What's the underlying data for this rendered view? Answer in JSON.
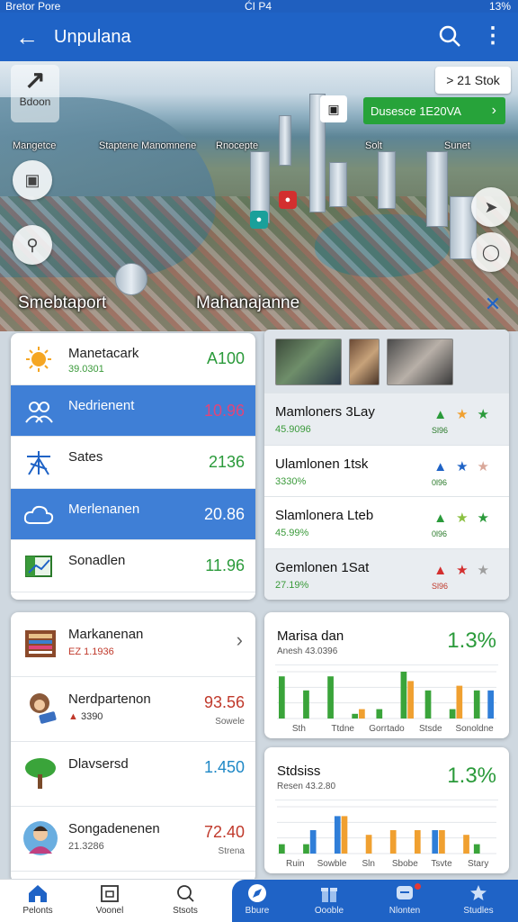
{
  "status_bar": {
    "left": "Bretor Pore",
    "center": "ĆI P4",
    "right": "13%"
  },
  "app_bar": {
    "title": "Unpulana"
  },
  "map": {
    "square_btn_label": "Bdoon",
    "square_label": "Mangetce",
    "time_chip": "> 21 Stok",
    "status_chip": "Dusesce 1E20VA",
    "labels": [
      "Staptene Manomnene",
      "Rnocepte",
      "Solt",
      "Sunet"
    ]
  },
  "sections": {
    "left_title": "Smebtaport",
    "right_title": "Mahanajanne"
  },
  "list": [
    {
      "name": "Manetacark",
      "sub": "39.0301",
      "value": "A100",
      "value_color": "#2a9a3a",
      "active": false,
      "icon": "sun-icon"
    },
    {
      "name": "Nedrienent",
      "sub": "",
      "value": "10.96",
      "value_color": "#e0457a",
      "active": true,
      "icon": "group-icon"
    },
    {
      "name": "Sates",
      "sub": "",
      "value": "2136",
      "value_color": "#2a9a3a",
      "active": false,
      "icon": "antenna-icon"
    },
    {
      "name": "Merlenanen",
      "sub": "",
      "value": "20.86",
      "value_color": "#ffffff",
      "active": true,
      "icon": "cloud-icon"
    },
    {
      "name": "Sonadlen",
      "sub": "",
      "value": "11.96",
      "value_color": "#2a9a3a",
      "active": false,
      "icon": "chart-icon"
    }
  ],
  "media": [
    {
      "name": "Mamloners 3Lay",
      "sub": "45.9096",
      "tiny": "Sl96",
      "stars": [
        "#2a9a3a",
        "#f0a030",
        "#2a9a3a"
      ]
    },
    {
      "name": "Ulamlonen 1tsk",
      "sub": "3330%",
      "tiny": "0l96",
      "stars": [
        "#1f63c6",
        "#1f63c6",
        "#d9a89a"
      ]
    },
    {
      "name": "Slamlonera Lteb",
      "sub": "45.99%",
      "tiny": "0l96",
      "stars": [
        "#2a9a3a",
        "#8ac040",
        "#2a9a3a"
      ]
    },
    {
      "name": "Gemlonen 1Sat",
      "sub": "27.19%",
      "tiny": "Sl96",
      "stars": [
        "#d32f2f",
        "#d32f2f",
        "#9e9e9e"
      ]
    }
  ],
  "users": [
    {
      "name": "Markanenan",
      "sub": "EZ 1.1936",
      "value": "",
      "vsub": "",
      "value_color": "#333",
      "chevron": true,
      "icon": "book-icon"
    },
    {
      "name": "Nerdpartenon",
      "sub": "3390",
      "value": "93.56",
      "vsub": "Sowele",
      "value_color": "#c0392b",
      "chevron": false,
      "icon": "person-icon"
    },
    {
      "name": "Dlavsersd",
      "sub": "",
      "value": "1.450",
      "vsub": "",
      "value_color": "#1f88c6",
      "chevron": false,
      "icon": "tree-icon"
    },
    {
      "name": "Songadenenen",
      "sub": "21.3286",
      "value": "72.40",
      "vsub": "Strena",
      "value_color": "#c0392b",
      "chevron": false,
      "icon": "avatar-icon"
    }
  ],
  "stats": [
    {
      "title": "Marisa dan",
      "sub": "Anesh 43.0396",
      "pct": "1.3%",
      "chart_data": {
        "type": "bar",
        "categories": [
          "Sth",
          "Ttdne",
          "Gorrtado",
          "Stsde",
          "Sonoldne"
        ],
        "series": [
          {
            "color": "#3aa43a",
            "values": [
              9,
              6,
              9,
              1,
              2,
              10,
              6,
              2,
              6
            ]
          },
          {
            "color": "#f0a030",
            "values": [
              0,
              0,
              0,
              2,
              0,
              8,
              0,
              7,
              0
            ]
          },
          {
            "color": "#2f7ed8",
            "values": [
              0,
              0,
              0,
              0,
              0,
              0,
              0,
              0,
              6
            ]
          }
        ],
        "ylim": [
          0,
          10
        ],
        "grid": true
      }
    },
    {
      "title": "Stdsiss",
      "sub": "Resen 43.2.80",
      "pct": "1.3%",
      "chart_data": {
        "type": "bar",
        "categories": [
          "Ruin",
          "Sowble",
          "Sln",
          "Sbobe",
          "Tsvte",
          "Stary"
        ],
        "series": [
          {
            "color": "#3aa43a",
            "values": [
              2,
              2,
              0,
              0,
              0,
              0,
              0,
              0,
              2
            ]
          },
          {
            "color": "#2f7ed8",
            "values": [
              0,
              5,
              8,
              0,
              0,
              0,
              5,
              0,
              0
            ]
          },
          {
            "color": "#f0a030",
            "values": [
              0,
              0,
              8,
              4,
              5,
              5,
              5,
              4,
              0
            ]
          }
        ],
        "ylim": [
          0,
          10
        ],
        "grid": true
      }
    }
  ],
  "bottom_nav": [
    {
      "label": "Pelonts",
      "icon": "home-icon",
      "active": false
    },
    {
      "label": "Voonel",
      "icon": "box-icon",
      "active": false
    },
    {
      "label": "Stsots",
      "icon": "search-icon",
      "active": false
    },
    {
      "label": "Bbure",
      "icon": "compass-icon",
      "active": true
    },
    {
      "label": "Oooble",
      "icon": "gift-icon",
      "active": true
    },
    {
      "label": "Nlonten",
      "icon": "message-icon",
      "active": true,
      "badge": true
    },
    {
      "label": "Studles",
      "icon": "star-person-icon",
      "active": true
    }
  ],
  "colors": {
    "primary": "#1f63c6",
    "accent_green": "#27a33a"
  }
}
